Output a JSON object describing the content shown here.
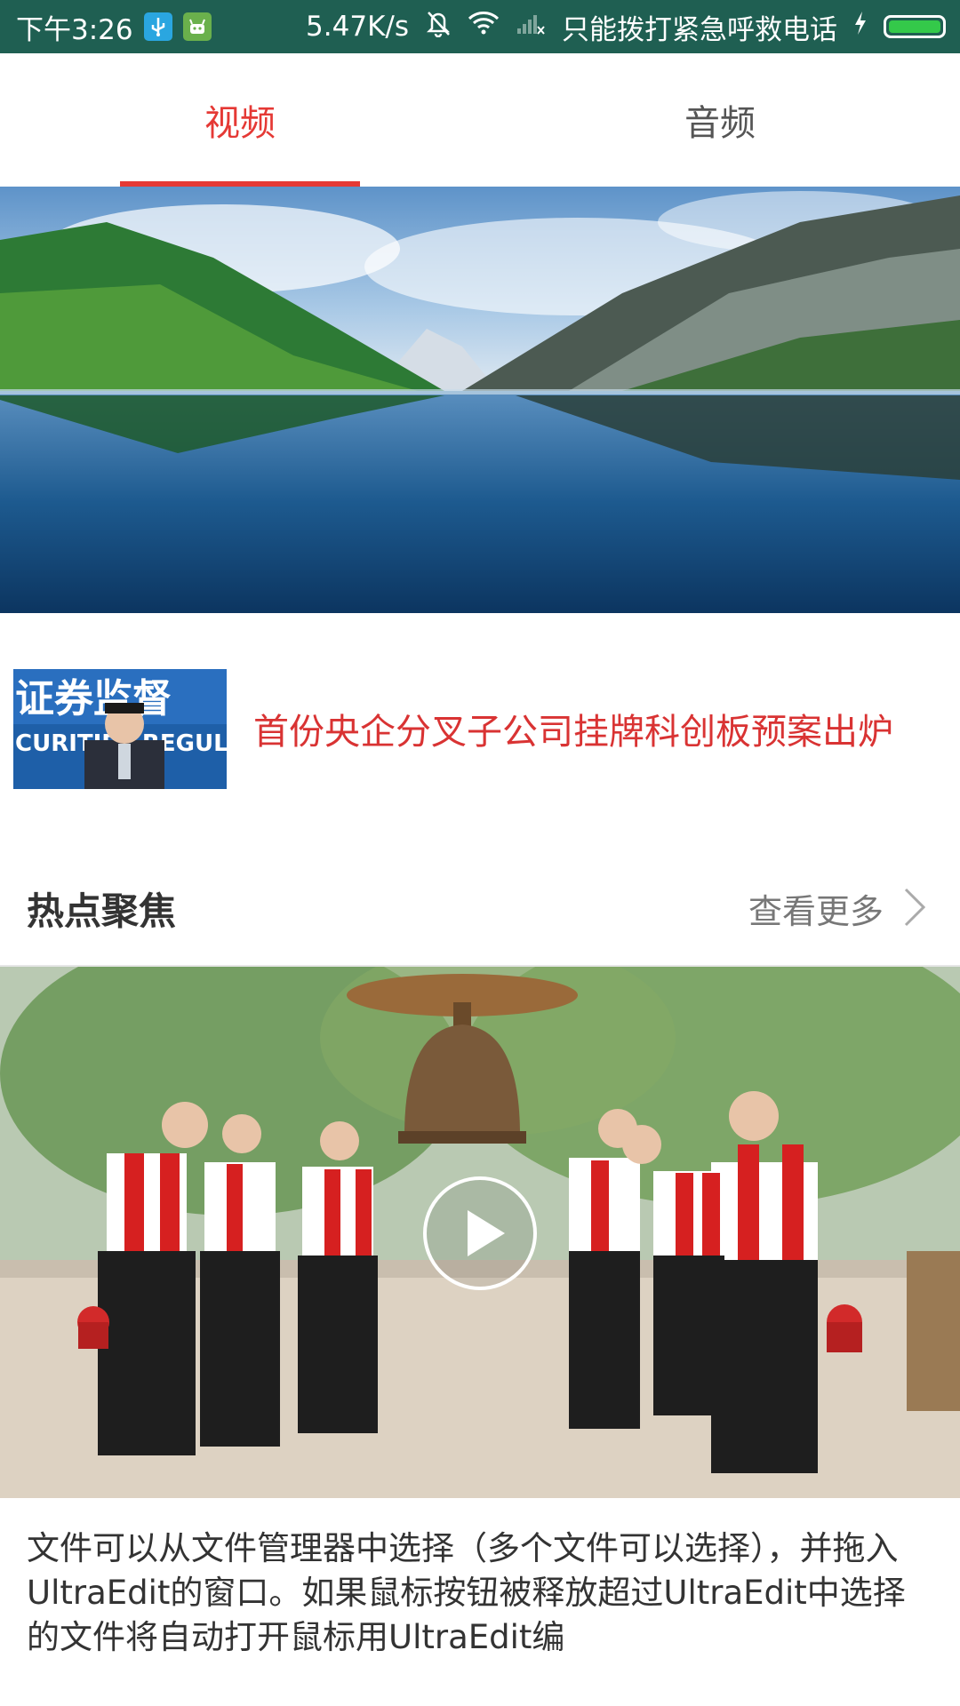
{
  "status_bar": {
    "time": "下午3:26",
    "usb_icon": "usb-icon",
    "app_icon": "android-icon",
    "speed": "5.47K/s",
    "mute_icon": "bell-off-icon",
    "wifi_icon": "wifi-icon",
    "signal_icon": "signal-off-icon",
    "carrier": "只能拨打紧急呼救电话",
    "charging_icon": "lightning-icon",
    "battery_icon": "battery-icon",
    "battery_level": 1.0,
    "colors": {
      "background": "#1f5f52",
      "usb": "#2aa6e0",
      "app": "#6ab04c",
      "battery_fill": "#34c94a"
    }
  },
  "tabs": [
    {
      "label": "视频",
      "active": true
    },
    {
      "label": "音频",
      "active": false
    }
  ],
  "headline": {
    "title": "首份央企分叉子公司挂牌科创板预案出炉",
    "thumb_text_top": "证券监督",
    "thumb_text_bottom": "CURITIES REGUL"
  },
  "section": {
    "title": "热点聚焦",
    "more_label": "查看更多",
    "more_icon": "chevron-right-icon"
  },
  "featured": {
    "play_icon": "play-icon",
    "caption": "文件可以从文件管理器中选择（多个文件可以选择），并拖入UltraEdit的窗口。如果鼠标按钮被释放超过UltraEdit中选择的文件将自动打开鼠标用UltraEdit编"
  },
  "colors": {
    "accent": "#e53935",
    "headline": "#d93333"
  }
}
